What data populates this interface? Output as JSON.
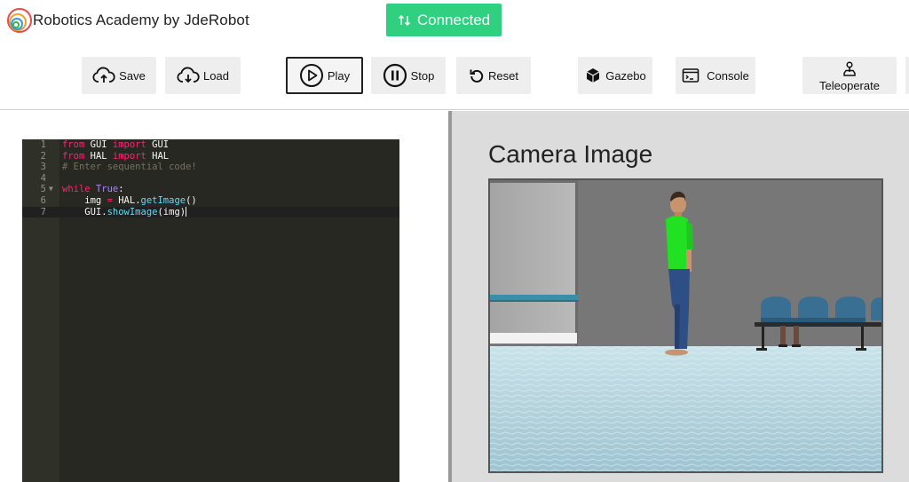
{
  "header": {
    "title": "Robotics Academy by JdeRobot",
    "status_label": "Connected",
    "status_color": "#2fd07f",
    "logo_icon": "robotics-academy-logo"
  },
  "toolbar": {
    "save_label": "Save",
    "load_label": "Load",
    "play_label": "Play",
    "stop_label": "Stop",
    "reset_label": "Reset",
    "gazebo_label": "Gazebo",
    "console_label": "Console",
    "teleoperate_label": "Teleoperate"
  },
  "editor": {
    "language": "python",
    "lines": [
      {
        "num": "1",
        "text": "from GUI import GUI"
      },
      {
        "num": "2",
        "text": "from HAL import HAL"
      },
      {
        "num": "3",
        "text": "# Enter sequential code!"
      },
      {
        "num": "4",
        "text": ""
      },
      {
        "num": "5",
        "text": "while True:"
      },
      {
        "num": "6",
        "text": "    img = HAL.getImage()"
      },
      {
        "num": "7",
        "text": "    GUI.showImage(img)"
      }
    ],
    "active_line": 7
  },
  "camera": {
    "title": "Camera Image"
  }
}
